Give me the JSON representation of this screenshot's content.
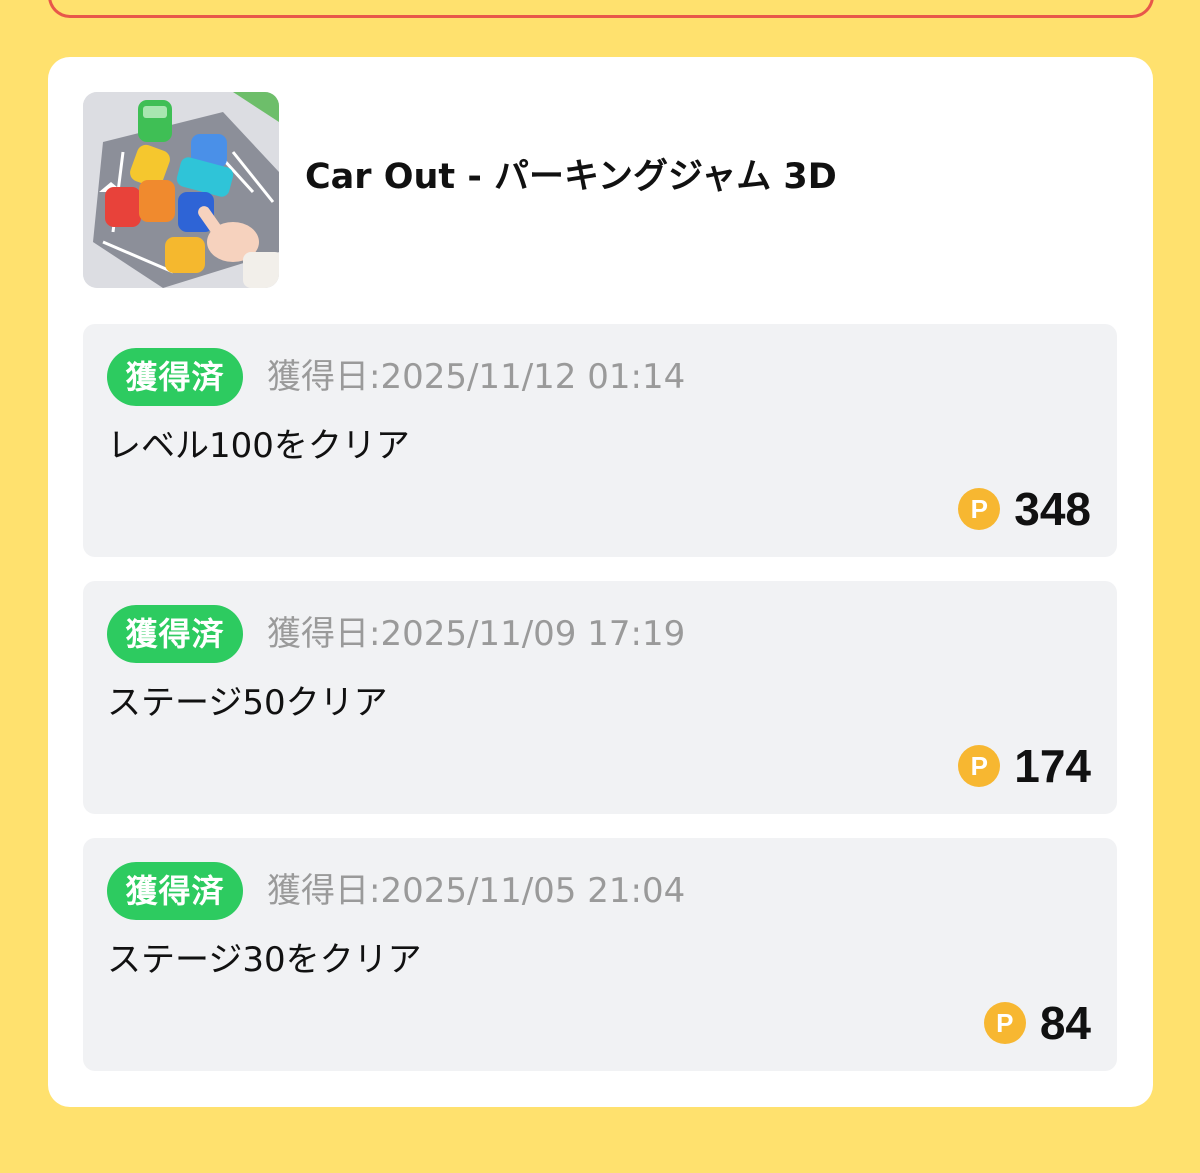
{
  "app": {
    "title": "Car Out - パーキングジャム 3D",
    "icon": "car-out-app-icon"
  },
  "colors": {
    "background": "#FFE16E",
    "badge": "#2DCB60",
    "coin": "#F7B731",
    "prev_card_border": "#E8574A"
  },
  "achievements": [
    {
      "badge": "獲得済",
      "date": "獲得日:2025/11/12 01:14",
      "mission": "レベル100をクリア",
      "coin_icon": "P",
      "points": "348"
    },
    {
      "badge": "獲得済",
      "date": "獲得日:2025/11/09 17:19",
      "mission": "ステージ50クリア",
      "coin_icon": "P",
      "points": "174"
    },
    {
      "badge": "獲得済",
      "date": "獲得日:2025/11/05 21:04",
      "mission": "ステージ30をクリア",
      "coin_icon": "P",
      "points": "84"
    }
  ]
}
